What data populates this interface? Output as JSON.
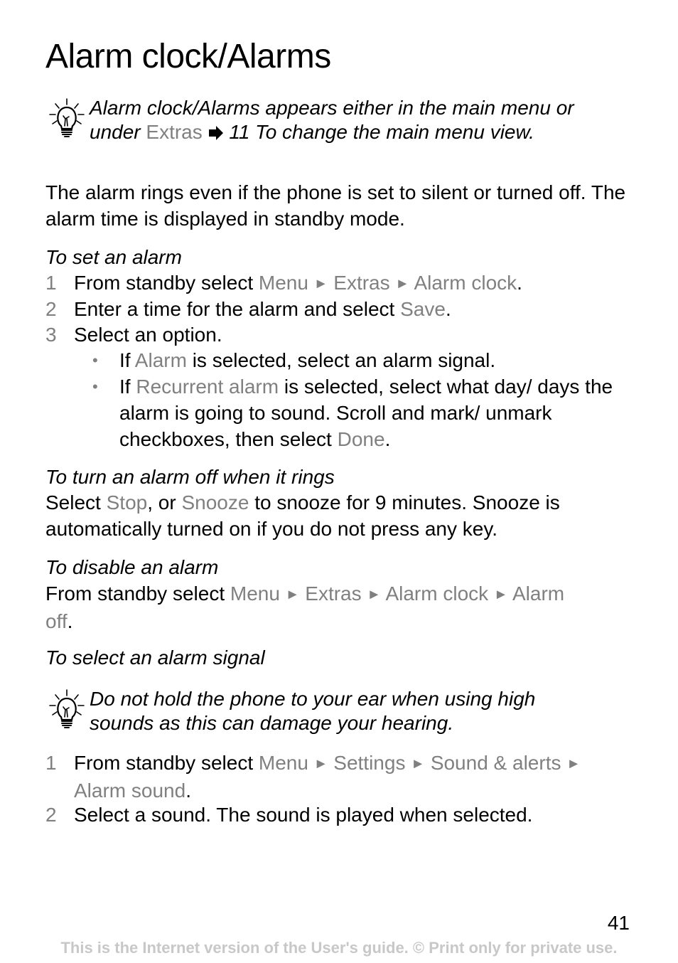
{
  "title": "Alarm clock/Alarms",
  "tip1": {
    "icon": "lightbulb-icon",
    "pre": "Alarm clock/Alarms appears either in the main menu or under ",
    "link": "Extras",
    "arrow_icon": "arrow-right-icon",
    "post": " 11 To change the main menu view."
  },
  "intro": "The alarm rings even if the phone is set to silent or turned off. The alarm time is displayed in standby mode.",
  "set_alarm": {
    "heading": "To set an alarm",
    "steps": [
      {
        "num": "1",
        "pre": "From standby select ",
        "path": [
          "Menu",
          "Extras",
          "Alarm clock"
        ],
        "post": "."
      },
      {
        "num": "2",
        "pre": "Enter a time for the alarm and select ",
        "path": [
          "Save"
        ],
        "post": "."
      },
      {
        "num": "3",
        "pre": "Select an option.",
        "path": [],
        "post": ""
      }
    ],
    "bullets": [
      {
        "pre": "If ",
        "hl": "Alarm",
        "post": " is selected, select an alarm signal.",
        "hl2": "",
        "post2": ""
      },
      {
        "pre": "If ",
        "hl": "Recurrent alarm",
        "post": " is selected, select what day/ days the alarm is going to sound. Scroll and mark/ unmark checkboxes, then select ",
        "hl2": "Done",
        "post2": "."
      }
    ]
  },
  "turn_off": {
    "heading": "To turn an alarm off when it rings",
    "pre": "Select ",
    "hl1": "Stop",
    "mid": ", or ",
    "hl2": "Snooze",
    "post": " to snooze for 9 minutes. Snooze is automatically turned on if you do not press any key."
  },
  "disable": {
    "heading": "To disable an alarm",
    "pre": "From standby select ",
    "path": [
      "Menu",
      "Extras",
      "Alarm clock",
      "Alarm off"
    ],
    "post": "."
  },
  "signal": {
    "heading": "To select an alarm signal",
    "tip": "Do not hold the phone to your ear when using high sounds as this can damage your hearing.",
    "steps": [
      {
        "num": "1",
        "pre": "From standby select ",
        "path": [
          "Menu",
          "Settings",
          "Sound & alerts",
          "Alarm sound"
        ],
        "post": "."
      },
      {
        "num": "2",
        "pre": "Select a sound. The sound is played when selected.",
        "path": [],
        "post": ""
      }
    ]
  },
  "separator": "►",
  "bullet_char": "•",
  "page_number": "41",
  "footer": "This is the Internet version of the User's guide. © Print only for private use.",
  "colors": {
    "highlight": "#808080",
    "footer": "#c8c8c8",
    "text": "#000000"
  }
}
